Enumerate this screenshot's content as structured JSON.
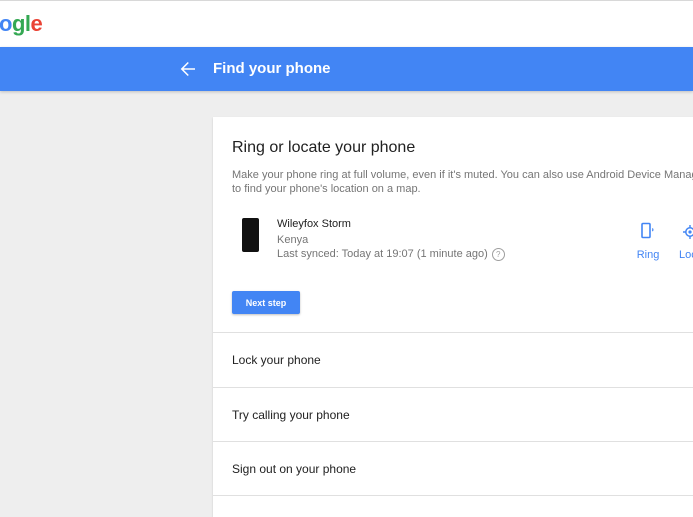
{
  "header": {
    "logo_text": "Google"
  },
  "appbar": {
    "title": "Find your phone",
    "back_icon": "arrow-left-icon"
  },
  "card": {
    "title": "Ring or locate your phone",
    "description_line1": "Make your phone ring at full volume, even if it's muted. You can also use Android Device Manag",
    "description_line2": "to find your phone's location on a map.",
    "device": {
      "name": "Wileyfox Storm",
      "country": "Kenya",
      "last_synced": "Last synced: Today at 19:07 (1 minute ago)",
      "help_icon": "help-circle-icon"
    },
    "actions": {
      "ring_label": "Ring",
      "locate_label": "Loca"
    },
    "next_button": "Next step"
  },
  "options": [
    {
      "label": "Lock your phone"
    },
    {
      "label": "Try calling your phone"
    },
    {
      "label": "Sign out on your phone"
    }
  ],
  "colors": {
    "accent": "#4285f4",
    "background": "#eeeeee"
  }
}
